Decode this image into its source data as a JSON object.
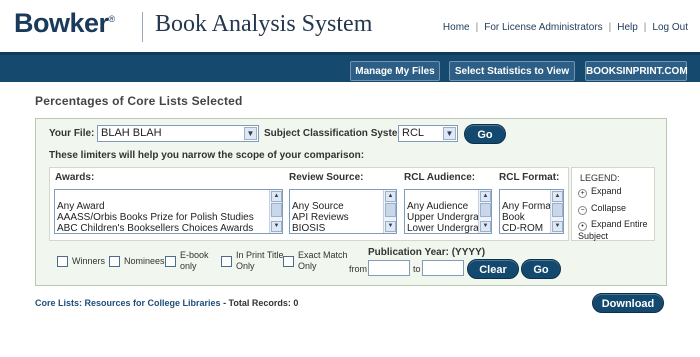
{
  "header": {
    "logo_text": "Bowker",
    "logo_reg": "®",
    "app_title": "Book Analysis System",
    "links": [
      "Home",
      "For License Administrators",
      "Help",
      "Log Out"
    ]
  },
  "nav": {
    "buttons": [
      "Manage My Files",
      "Select Statistics to View",
      "BOOKSINPRINT.COM"
    ]
  },
  "page_title": "Percentages of Core Lists Selected",
  "form": {
    "your_file_label": "Your File:",
    "your_file_value": "BLAH BLAH",
    "subject_system_label": "Subject Classification System",
    "subject_system_value": "RCL",
    "go_label": "Go",
    "limiters_text": "These limiters will help you narrow the scope of your comparison:"
  },
  "filters": {
    "awards": {
      "label": "Awards:",
      "options": [
        "Any Award",
        "AAASS/Orbis Books Prize for Polish Studies",
        "ABC Children's Booksellers Choices Awards"
      ]
    },
    "review_source": {
      "label": "Review Source:",
      "options": [
        "Any Source",
        "API Reviews",
        "BIOSIS"
      ]
    },
    "rcl_audience": {
      "label": "RCL Audience:",
      "options": [
        "Any Audience",
        "Upper Undergrad",
        "Lower Undergrad"
      ]
    },
    "rcl_format": {
      "label": "RCL Format:",
      "options": [
        "Any Format",
        "Book",
        "CD-ROM"
      ]
    }
  },
  "legend": {
    "title": "LEGEND:",
    "items": [
      {
        "symbol": "+",
        "label": "Expand"
      },
      {
        "symbol": "−",
        "label": "Collapse"
      },
      {
        "symbol": "•",
        "label": "Expand Entire Subject"
      }
    ]
  },
  "checkboxes": {
    "winners": "Winners",
    "nominees": "Nominees",
    "ebook_1": "E-book",
    "ebook_2": "only",
    "inprint_1": "In Print Title",
    "inprint_2": "Only",
    "exact_1": "Exact Match",
    "exact_2": "Only"
  },
  "publication_year": {
    "label": "Publication Year: (YYYY)",
    "from_label": "from",
    "to_label": "to",
    "from_value": "",
    "to_value": "",
    "clear_label": "Clear",
    "go_label": "Go"
  },
  "footer": {
    "core_lists_link": "Core Lists: Resources for College Libraries",
    "total_records": " - Total Records: 0",
    "download_label": "Download"
  }
}
